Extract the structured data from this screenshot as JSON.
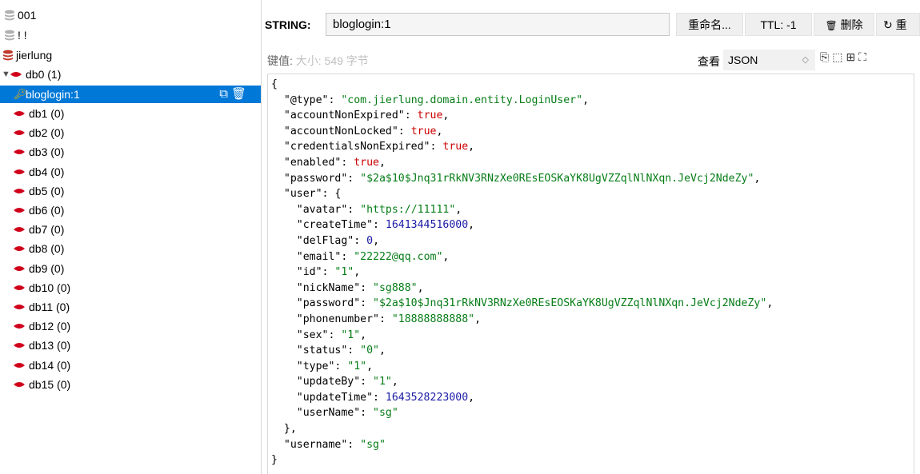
{
  "tree": {
    "connections": [
      {
        "label": "001"
      },
      {
        "label": "! !"
      },
      {
        "label": "jierlung"
      }
    ],
    "selected_key": "bloglogin:1",
    "databases": [
      {
        "label": "db0",
        "count": "(1)"
      },
      {
        "label": "db1",
        "count": "(0)"
      },
      {
        "label": "db2",
        "count": "(0)"
      },
      {
        "label": "db3",
        "count": "(0)"
      },
      {
        "label": "db4",
        "count": "(0)"
      },
      {
        "label": "db5",
        "count": "(0)"
      },
      {
        "label": "db6",
        "count": "(0)"
      },
      {
        "label": "db7",
        "count": "(0)"
      },
      {
        "label": "db8",
        "count": "(0)"
      },
      {
        "label": "db9",
        "count": "(0)"
      },
      {
        "label": "db10",
        "count": "(0)"
      },
      {
        "label": "db11",
        "count": "(0)"
      },
      {
        "label": "db12",
        "count": "(0)"
      },
      {
        "label": "db13",
        "count": "(0)"
      },
      {
        "label": "db14",
        "count": "(0)"
      },
      {
        "label": "db15",
        "count": "(0)"
      }
    ],
    "icons": {
      "server": "server-stack-icon",
      "db": "database-icon",
      "key": "key-icon",
      "copy": "copy-icon",
      "delete": "trash-icon"
    },
    "colors": {
      "db_red": "#d0021b",
      "server_red": "#c0392b",
      "server_gray": "#aaaaaa",
      "selected_bg": "#0078d7",
      "key_yellow": "#f5b400"
    }
  },
  "detail": {
    "type_label": "STRING:",
    "key_value": "bloglogin:1",
    "rename_label": "重命名...",
    "ttl_label": "TTL:  -1",
    "delete_label": "删除",
    "reload_label": "重",
    "meta_prefix": "键值:",
    "meta_size": "大小: 549 字节",
    "view_label": "查看",
    "format_value": "JSON"
  },
  "json_lines": [
    [
      [
        "k",
        "{"
      ]
    ],
    [
      [
        "k",
        "  "
      ],
      [
        "k",
        "\"@type\": "
      ],
      [
        "s",
        "\"com.jierlung.domain.entity.LoginUser\""
      ],
      [
        "k",
        ","
      ]
    ],
    [
      [
        "k",
        "  "
      ],
      [
        "k",
        "\"accountNonExpired\": "
      ],
      [
        "b",
        "true"
      ],
      [
        "k",
        ","
      ]
    ],
    [
      [
        "k",
        "  "
      ],
      [
        "k",
        "\"accountNonLocked\": "
      ],
      [
        "b",
        "true"
      ],
      [
        "k",
        ","
      ]
    ],
    [
      [
        "k",
        "  "
      ],
      [
        "k",
        "\"credentialsNonExpired\": "
      ],
      [
        "b",
        "true"
      ],
      [
        "k",
        ","
      ]
    ],
    [
      [
        "k",
        "  "
      ],
      [
        "k",
        "\"enabled\": "
      ],
      [
        "b",
        "true"
      ],
      [
        "k",
        ","
      ]
    ],
    [
      [
        "k",
        "  "
      ],
      [
        "k",
        "\"password\": "
      ],
      [
        "s",
        "\"$2a$10$Jnq31rRkNV3RNzXe0REsEOSKaYK8UgVZZqlNlNXqn.JeVcj2NdeZy\""
      ],
      [
        "k",
        ","
      ]
    ],
    [
      [
        "k",
        "  "
      ],
      [
        "k",
        "\"user\": {"
      ]
    ],
    [
      [
        "k",
        "    "
      ],
      [
        "k",
        "\"avatar\": "
      ],
      [
        "s",
        "\"https://11111\""
      ],
      [
        "k",
        ","
      ]
    ],
    [
      [
        "k",
        "    "
      ],
      [
        "k",
        "\"createTime\": "
      ],
      [
        "n",
        "1641344516000"
      ],
      [
        "k",
        ","
      ]
    ],
    [
      [
        "k",
        "    "
      ],
      [
        "k",
        "\"delFlag\": "
      ],
      [
        "n",
        "0"
      ],
      [
        "k",
        ","
      ]
    ],
    [
      [
        "k",
        "    "
      ],
      [
        "k",
        "\"email\": "
      ],
      [
        "s",
        "\"22222@qq.com\""
      ],
      [
        "k",
        ","
      ]
    ],
    [
      [
        "k",
        "    "
      ],
      [
        "k",
        "\"id\": "
      ],
      [
        "s",
        "\"1\""
      ],
      [
        "k",
        ","
      ]
    ],
    [
      [
        "k",
        "    "
      ],
      [
        "k",
        "\"nickName\": "
      ],
      [
        "s",
        "\"sg888\""
      ],
      [
        "k",
        ","
      ]
    ],
    [
      [
        "k",
        "    "
      ],
      [
        "k",
        "\"password\": "
      ],
      [
        "s",
        "\"$2a$10$Jnq31rRkNV3RNzXe0REsEOSKaYK8UgVZZqlNlNXqn.JeVcj2NdeZy\""
      ],
      [
        "k",
        ","
      ]
    ],
    [
      [
        "k",
        "    "
      ],
      [
        "k",
        "\"phonenumber\": "
      ],
      [
        "s",
        "\"18888888888\""
      ],
      [
        "k",
        ","
      ]
    ],
    [
      [
        "k",
        "    "
      ],
      [
        "k",
        "\"sex\": "
      ],
      [
        "s",
        "\"1\""
      ],
      [
        "k",
        ","
      ]
    ],
    [
      [
        "k",
        "    "
      ],
      [
        "k",
        "\"status\": "
      ],
      [
        "s",
        "\"0\""
      ],
      [
        "k",
        ","
      ]
    ],
    [
      [
        "k",
        "    "
      ],
      [
        "k",
        "\"type\": "
      ],
      [
        "s",
        "\"1\""
      ],
      [
        "k",
        ","
      ]
    ],
    [
      [
        "k",
        "    "
      ],
      [
        "k",
        "\"updateBy\": "
      ],
      [
        "s",
        "\"1\""
      ],
      [
        "k",
        ","
      ]
    ],
    [
      [
        "k",
        "    "
      ],
      [
        "k",
        "\"updateTime\": "
      ],
      [
        "n",
        "1643528223000"
      ],
      [
        "k",
        ","
      ]
    ],
    [
      [
        "k",
        "    "
      ],
      [
        "k",
        "\"userName\": "
      ],
      [
        "s",
        "\"sg\""
      ]
    ],
    [
      [
        "k",
        "  "
      ],
      [
        "k",
        "},"
      ]
    ],
    [
      [
        "k",
        "  "
      ],
      [
        "k",
        "\"username\": "
      ],
      [
        "s",
        "\"sg\""
      ]
    ],
    [
      [
        "k",
        "}"
      ]
    ]
  ]
}
